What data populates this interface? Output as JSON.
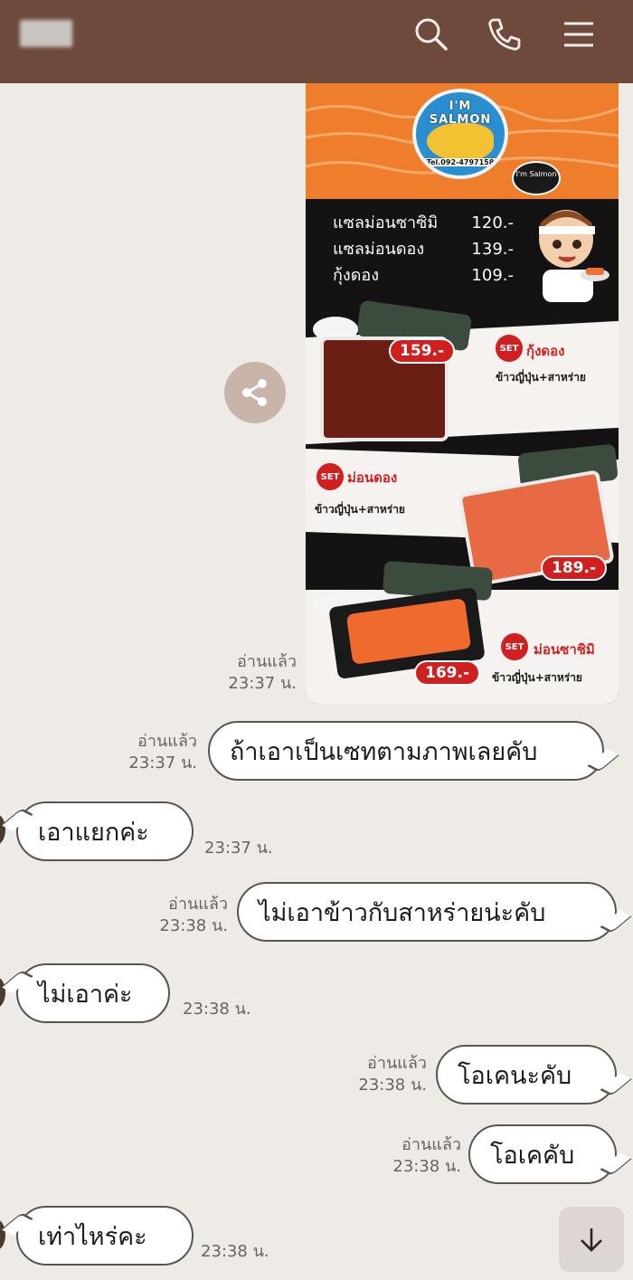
{
  "header": {
    "contact_name_hidden": true,
    "icons": [
      "search-icon",
      "phone-icon",
      "menu-icon"
    ]
  },
  "menu_image": {
    "logo_text": "I'M SALMON",
    "logo_tel": "Tel.092-4797158",
    "speech_bubble": "I'm Salmon",
    "price_list": [
      {
        "name": "แซลม่อนซาซิมิ",
        "price": "120.-"
      },
      {
        "name": "แซลม่อนดอง",
        "price": "139.-"
      },
      {
        "name": "กุ้งดอง",
        "price": "109.-"
      }
    ],
    "sets": [
      {
        "badge": "SET",
        "title": "กุ้งดอง",
        "subtitle": "ข้าวญี่ปุ่น+สาหร่าย",
        "price": "159.-"
      },
      {
        "badge": "SET",
        "title": "ม่อนดอง",
        "subtitle": "ข้าวญี่ปุ่น+สาหร่าย",
        "price": "189.-"
      },
      {
        "badge": "SET",
        "title": "ม่อนซาชิมิ",
        "subtitle": "ข้าวญี่ปุ่น+สาหร่าย",
        "price": "169.-"
      }
    ]
  },
  "messages": [
    {
      "id": "m0",
      "side": "out",
      "type": "image",
      "read": "อ่านแล้ว",
      "time": "23:37 น."
    },
    {
      "id": "m1",
      "side": "out",
      "text": "ถ้าเอาเป็นเซทตามภาพเลยคับ",
      "read": "อ่านแล้ว",
      "time": "23:37 น."
    },
    {
      "id": "m2",
      "side": "in",
      "text": "เอาแยกค่ะ",
      "time": "23:37 น."
    },
    {
      "id": "m3",
      "side": "out",
      "text": "ไม่เอาข้าวกับสาหร่ายน่ะคับ",
      "read": "อ่านแล้ว",
      "time": "23:38 น."
    },
    {
      "id": "m4",
      "side": "in",
      "text": "ไม่เอาค่ะ",
      "time": "23:38 น."
    },
    {
      "id": "m5",
      "side": "out",
      "text": "โอเคนะคับ",
      "read": "อ่านแล้ว",
      "time": "23:38 น."
    },
    {
      "id": "m6",
      "side": "out",
      "text": "โอเคคับ",
      "read": "อ่านแล้ว",
      "time": "23:38 น."
    },
    {
      "id": "m7",
      "side": "in",
      "text": "เท่าไหร่คะ",
      "time": "23:38 น."
    }
  ],
  "colors": {
    "header_bg": "#6e4a3c",
    "chat_bg": "#eeebe6",
    "bubble_border": "#5b5552",
    "accent_orange": "#ee7d2c",
    "price_red": "#cf1f1f"
  }
}
